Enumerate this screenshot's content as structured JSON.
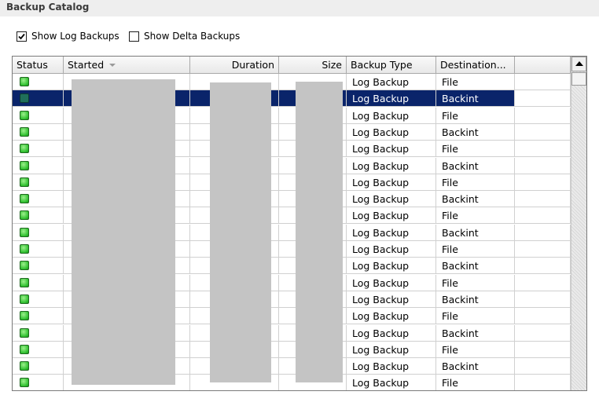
{
  "header": {
    "title": "Backup Catalog"
  },
  "options": {
    "show_log_backups": {
      "label": "Show Log Backups",
      "checked": true
    },
    "show_delta_backups": {
      "label": "Show Delta Backups",
      "checked": false
    }
  },
  "table": {
    "columns": [
      "Status",
      "Started",
      "Duration",
      "Size",
      "Backup Type",
      "Destination..."
    ],
    "sorted_column": "Started",
    "rows": [
      {
        "type": "Log Backup",
        "destination": "File"
      },
      {
        "type": "Log Backup",
        "destination": "Backint",
        "selected": true
      },
      {
        "type": "Log Backup",
        "destination": "File"
      },
      {
        "type": "Log Backup",
        "destination": "Backint"
      },
      {
        "type": "Log Backup",
        "destination": "File"
      },
      {
        "type": "Log Backup",
        "destination": "Backint"
      },
      {
        "type": "Log Backup",
        "destination": "File"
      },
      {
        "type": "Log Backup",
        "destination": "Backint"
      },
      {
        "type": "Log Backup",
        "destination": "File"
      },
      {
        "type": "Log Backup",
        "destination": "Backint"
      },
      {
        "type": "Log Backup",
        "destination": "File"
      },
      {
        "type": "Log Backup",
        "destination": "Backint"
      },
      {
        "type": "Log Backup",
        "destination": "File"
      },
      {
        "type": "Log Backup",
        "destination": "Backint"
      },
      {
        "type": "Log Backup",
        "destination": "File"
      },
      {
        "type": "Log Backup",
        "destination": "Backint"
      },
      {
        "type": "Log Backup",
        "destination": "File"
      },
      {
        "type": "Log Backup",
        "destination": "Backint"
      },
      {
        "type": "Log Backup",
        "destination": "File"
      }
    ]
  },
  "colors": {
    "selection": "#0a246a",
    "status_ok": "#2fbf2f",
    "header_bg": "#eeeeee"
  }
}
